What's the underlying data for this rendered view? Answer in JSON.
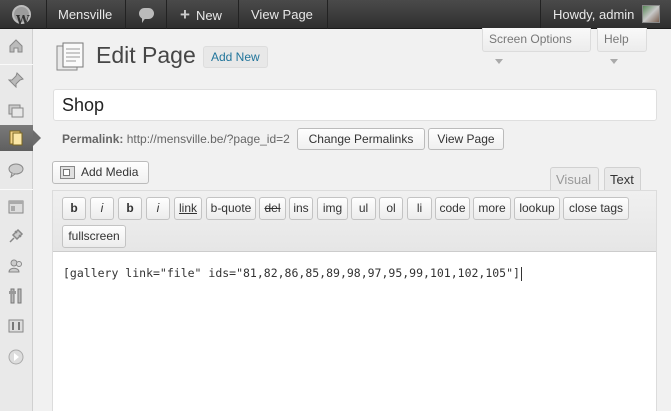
{
  "adminbar": {
    "site_name": "Mensville",
    "new_label": "New",
    "new_icon": "plus-icon",
    "view_page": "View Page",
    "howdy": "Howdy, admin"
  },
  "tabs": {
    "screen_options": "Screen Options",
    "help": "Help"
  },
  "header": {
    "title": "Edit Page",
    "add_new": "Add New"
  },
  "post": {
    "title": "Shop",
    "permalink_label": "Permalink:",
    "permalink_url": "http://mensville.be/?page_id=2",
    "change_permalinks": "Change Permalinks",
    "view_page": "View Page"
  },
  "editor": {
    "add_media": "Add Media",
    "tab_visual": "Visual",
    "tab_text": "Text",
    "quicktags": [
      "b",
      "i",
      "b",
      "i",
      "link",
      "b-quote",
      "del",
      "ins",
      "img",
      "ul",
      "ol",
      "li",
      "code",
      "more",
      "lookup",
      "close tags",
      "fullscreen"
    ],
    "content": "[gallery link=\"file\" ids=\"81,82,86,85,89,98,97,95,99,101,102,105\"]"
  },
  "sidebar": {
    "icons": [
      "dashboard-icon",
      "pin-icon",
      "media-icon",
      "pages-icon",
      "comments-icon",
      "appearance-icon",
      "plugins-icon",
      "users-icon",
      "tools-icon",
      "settings-icon",
      "collapse-icon"
    ]
  }
}
